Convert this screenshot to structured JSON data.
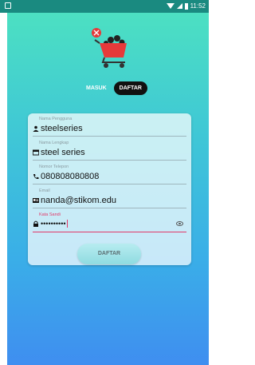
{
  "status_bar": {
    "time": "11:52"
  },
  "tabs": [
    {
      "label": "MASUK",
      "active": false
    },
    {
      "label": "DAFTAR",
      "active": true
    }
  ],
  "form": {
    "fields": [
      {
        "label": "Nama Pengguna",
        "value": "steelseries",
        "icon": "person-icon"
      },
      {
        "label": "Nama Lengkap",
        "value": "steel series",
        "icon": "id-card-icon"
      },
      {
        "label": "Nomor Telepon",
        "value": "080808080808",
        "icon": "phone-icon"
      },
      {
        "label": "Email",
        "value": "nanda@stikom.edu",
        "icon": "contact-card-icon"
      },
      {
        "label": "Kata Sandi",
        "value": "••••••••••",
        "icon": "lock-icon"
      }
    ],
    "submit_label": "DAFTAR"
  },
  "colors": {
    "accent_pink": "#e23868",
    "status_bar": "#1a8a80",
    "gradient_top": "#4ce0c2",
    "gradient_bottom": "#3f8ef0"
  }
}
